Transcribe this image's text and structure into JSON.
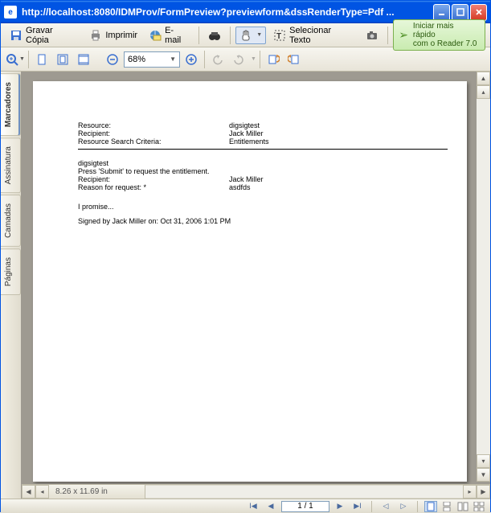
{
  "window": {
    "title": "http://localhost:8080/IDMProv/FormPreview?previewform&dssRenderType=Pdf ..."
  },
  "toolbar1": {
    "save_copy": "Gravar Cópia",
    "print": "Imprimir",
    "email": "E-mail",
    "select_text": "Selecionar Texto"
  },
  "promo": {
    "line1": "Iniciar mais rápido",
    "line2": "com o Reader 7.0"
  },
  "toolbar2": {
    "zoom_value": "68%"
  },
  "side_tabs": {
    "t0": "Marcadores",
    "t1": "Assinatura",
    "t2": "Camadas",
    "t3": "Páginas"
  },
  "statusbar": {
    "dimensions": "8.26 x 11.69 in",
    "page_of": "1 / 1"
  },
  "doc": {
    "r1_lbl": "Resource:",
    "r1_val": "digsigtest",
    "r2_lbl": "Recipient:",
    "r2_val": "Jack Miller",
    "r3_lbl": "Resource Search Criteria:",
    "r3_val": "Entitlements",
    "b1": "digsigtest",
    "b2": "Press 'Submit' to request the entitlement.",
    "b3_lbl": "Recipient:",
    "b3_val": "Jack Miller",
    "b4_lbl": "Reason for request: *",
    "b4_val": "asdfds",
    "b5": "I promise...",
    "b6": "Signed by Jack Miller on: Oct 31, 2006 1:01 PM"
  }
}
